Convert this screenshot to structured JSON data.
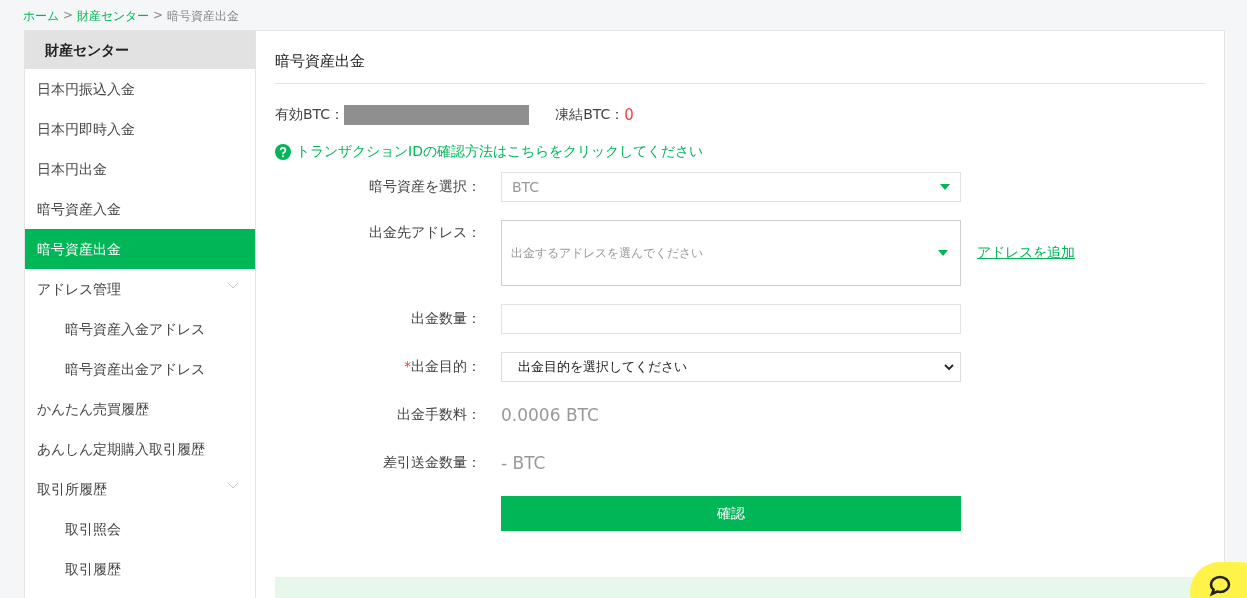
{
  "breadcrumb": [
    {
      "label": "ホーム",
      "link": true
    },
    {
      "label": "財産センター",
      "link": true
    },
    {
      "label": "暗号資産出金",
      "link": false
    }
  ],
  "breadcrumb_separator": ">",
  "sidebar": {
    "title": "財産センター",
    "items": [
      {
        "label": "日本円振込入金",
        "selected": false
      },
      {
        "label": "日本円即時入金",
        "selected": false
      },
      {
        "label": "日本円出金",
        "selected": false
      },
      {
        "label": "暗号資産入金",
        "selected": false
      },
      {
        "label": "暗号資産出金",
        "selected": true
      },
      {
        "label": "アドレス管理",
        "selected": false,
        "expanded": true,
        "children": [
          {
            "label": "暗号資産入金アドレス",
            "selected": false
          },
          {
            "label": "暗号資産出金アドレス",
            "selected": false
          }
        ]
      },
      {
        "label": "かんたん売買履歴",
        "selected": false
      },
      {
        "label": "あんしん定期購入取引履歴",
        "selected": false
      },
      {
        "label": "取引所履歴",
        "selected": false,
        "expanded": true,
        "children": [
          {
            "label": "取引照会",
            "selected": false
          },
          {
            "label": "取引履歴",
            "selected": false
          }
        ]
      }
    ]
  },
  "panel": {
    "title": "暗号資産出金",
    "balances": [
      {
        "label": "有効BTC：",
        "redacted": true
      },
      {
        "label": "凍結BTC：",
        "value": "0",
        "redacted": false
      }
    ],
    "help_link": "トランザクションIDの確認方法はこちらをクリックしてください",
    "form": [
      {
        "kind": "dropdown",
        "label": "暗号資産を選択：",
        "value": "BTC",
        "required": false
      },
      {
        "kind": "address",
        "label": "出金先アドレス：",
        "placeholder": "出金するアドレスを選んでください",
        "required": false,
        "link": "アドレスを追加"
      },
      {
        "kind": "input",
        "label": "出金数量：",
        "required": false
      },
      {
        "kind": "select",
        "label": "出金目的：",
        "value": "出金目的を選択してください",
        "required": true
      },
      {
        "kind": "text",
        "label": "出金手数料：",
        "value": "0.0006 BTC",
        "required": false
      },
      {
        "kind": "text",
        "label": "差引送金数量：",
        "value": "- BTC",
        "required": false
      }
    ],
    "required_mark": "*",
    "submit": "確認"
  }
}
